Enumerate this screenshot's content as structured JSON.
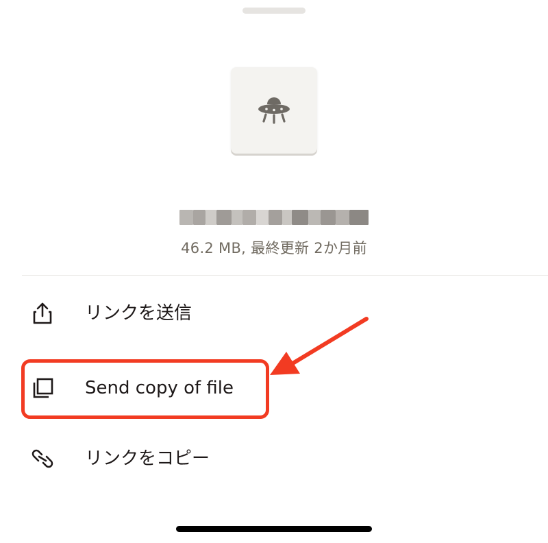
{
  "sheet": {
    "file": {
      "name": "■■■■■■■■■■■■■■■■■■■■■■",
      "name_redacted": true,
      "meta": "46.2 MB, 最終更新 2か月前",
      "thumbnail_icon": "ufo-icon"
    },
    "actions": [
      {
        "label": "リンクを送信",
        "icon": "share-upload-icon"
      },
      {
        "label": "Send copy of file",
        "icon": "copy-pages-icon"
      },
      {
        "label": "リンクをコピー",
        "icon": "link-icon"
      }
    ]
  },
  "annotation": {
    "highlighted_action": "Send copy of file",
    "color": "#f23b22"
  },
  "colors": {
    "text_primary": "#1e1919",
    "text_secondary": "#716b61",
    "thumbnail_bg": "#f4f3f0",
    "icon_gray": "#6e6a64"
  }
}
